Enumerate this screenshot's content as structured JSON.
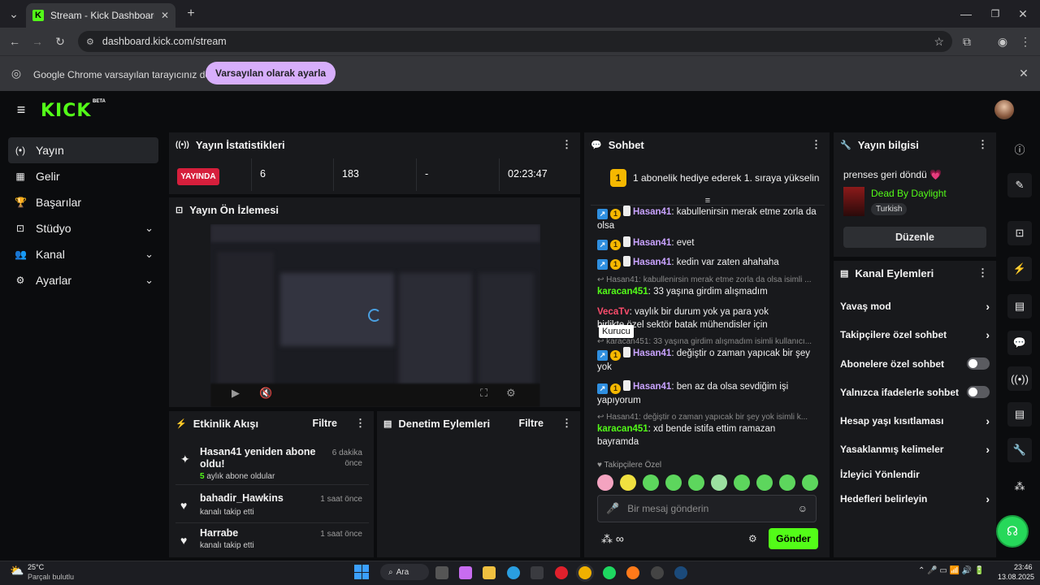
{
  "browser": {
    "tab_title": "Stream - Kick Dashboard",
    "url": "dashboard.kick.com/stream",
    "info_message": "Google Chrome varsayılan tarayıcınız değil",
    "set_default_label": "Varsayılan olarak ayarla"
  },
  "header": {
    "logo": "KICK",
    "beta": "BETA"
  },
  "sidebar": {
    "items": [
      {
        "label": "Yayın",
        "icon": "broadcast-icon"
      },
      {
        "label": "Gelir",
        "icon": "chart-icon"
      },
      {
        "label": "Başarılar",
        "icon": "trophy-icon"
      },
      {
        "label": "Stüdyo",
        "icon": "studio-icon"
      },
      {
        "label": "Kanal",
        "icon": "users-icon"
      },
      {
        "label": "Ayarlar",
        "icon": "gear-icon"
      }
    ]
  },
  "stats": {
    "title": "Yayın İstatistikleri",
    "live_label": "YAYINDA",
    "values": [
      "6",
      "183",
      "-",
      "02:23:47"
    ]
  },
  "preview": {
    "title": "Yayın Ön İzlemesi"
  },
  "activity": {
    "title": "Etkinlik Akışı",
    "filter": "Filtre",
    "items": [
      {
        "name": "Hasan41 yeniden abone oldu!",
        "time": "6 dakika önce",
        "count": "5",
        "sub": " aylık abone oldular"
      },
      {
        "name": "bahadir_Hawkins",
        "time": "1 saat önce",
        "sub": "kanalı takip etti"
      },
      {
        "name": "Harrabe",
        "time": "1 saat önce",
        "sub": "kanalı takip etti"
      }
    ]
  },
  "moderation": {
    "title": "Denetim Eylemleri",
    "filter": "Filtre"
  },
  "chat": {
    "title": "Sohbet",
    "pinned_count": "1",
    "pinned_text": "1 abonelik hediye ederek 1. sıraya yükselin",
    "lines": [
      {
        "user": "Hasan41",
        "text": "kabullenirsin merak etme zorla da olsa"
      },
      {
        "user": "Hasan41",
        "text": "evet"
      },
      {
        "user": "Hasan41",
        "text": "kedin var zaten ahahaha"
      },
      {
        "reply": "Hasan41: kabullenirsin merak etme zorla da olsa isimli ...",
        "user": "karacan451",
        "text": "33 yaşına girdim alışmadım"
      },
      {
        "user": "VecaTv",
        "text": "vaylık bir durum yok ya para yok"
      },
      {
        "text": "birlikte özel sektör batak mühendisler için"
      },
      {
        "reply": "karacan451: 33 yaşına girdim alışmadım isimli kullanıcı...",
        "user": "Hasan41",
        "text": "değiştir o zaman yapıcak bir şey yok"
      },
      {
        "user": "Hasan41",
        "text": "ben az da olsa sevdiğim işi yapıyorum"
      },
      {
        "reply": "Hasan41: değiştir o zaman yapıcak bir şey yok isimli k...",
        "user": "karacan451",
        "text": "xd bende istifa ettim ramazan bayramda"
      }
    ],
    "tooltip": "Kurucu",
    "emote_label": "Takipçilere Özel",
    "input_placeholder": "Bir mesaj gönderin",
    "send_label": "Gönder",
    "user_colors": {
      "Hasan41": "#c9a3ff",
      "karacan451": "#53fc18",
      "VecaTv": "#ff4d6d"
    }
  },
  "info": {
    "title": "Yayın bilgisi",
    "stream_title": "prenses geri döndü 💗",
    "game": "Dead By Daylight",
    "language": "Turkish",
    "edit_label": "Düzenle"
  },
  "channel_actions": {
    "title": "Kanal Eylemleri",
    "items": [
      {
        "label": "Yavaş mod",
        "kind": "chevron"
      },
      {
        "label": "Takipçilere özel sohbet",
        "kind": "chevron"
      },
      {
        "label": "Abonelere özel sohbet",
        "kind": "toggle"
      },
      {
        "label": "Yalnızca ifadelerle sohbet",
        "kind": "toggle"
      },
      {
        "label": "Hesap yaşı kısıtlaması",
        "kind": "chevron"
      },
      {
        "label": "Yasaklanmış kelimeler",
        "kind": "chevron"
      },
      {
        "label": "İzleyici Yönlendir",
        "kind": "none"
      },
      {
        "label": "Hedefleri belirleyin",
        "kind": "chevron"
      }
    ]
  },
  "taskbar": {
    "weather_temp": "25°C",
    "weather_desc": "Parçalı bulutlu",
    "search": "Ara",
    "time": "23:46",
    "date": "13.08.2025"
  },
  "colors": {
    "accent": "#53fc18",
    "live": "#d61f3c",
    "panel": "#18191c"
  }
}
